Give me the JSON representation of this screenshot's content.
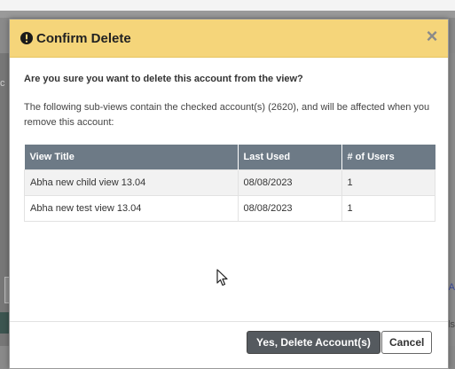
{
  "dialog": {
    "title": "Confirm Delete",
    "close_label": "×",
    "question": "Are you sure you want to delete this account from the view?",
    "description": "The following sub-views contain the checked account(s) (2620), and will be affected when you remove this account:",
    "table": {
      "headers": [
        "View Title",
        "Last Used",
        "# of Users"
      ],
      "rows": [
        [
          "Abha new child view 13.04",
          "08/08/2023",
          "1"
        ],
        [
          "Abha new test view 13.04",
          "08/08/2023",
          "1"
        ]
      ]
    },
    "confirm_label": "Yes, Delete Account(s)",
    "cancel_label": "Cancel",
    "header_color": "#f5d57a",
    "table_header_color": "#6d7a86"
  },
  "background": {
    "left_text": "c",
    "right_text": "A",
    "right_text2": "ls"
  },
  "icons": [
    "exclamation-circle-icon",
    "close-icon",
    "mouse-cursor-icon"
  ]
}
